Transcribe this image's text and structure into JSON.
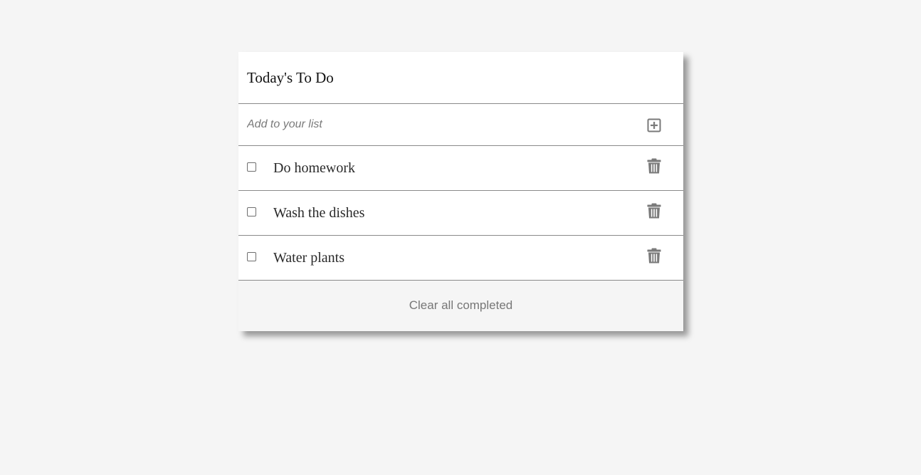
{
  "app": {
    "title": "Today's To Do"
  },
  "add": {
    "placeholder": "Add to your list",
    "value": "",
    "icon": "plus-square-icon"
  },
  "todos": [
    {
      "text": "Do homework",
      "checked": false,
      "delete_icon": "trash-icon"
    },
    {
      "text": "Wash the dishes",
      "checked": false,
      "delete_icon": "trash-icon"
    },
    {
      "text": "Water plants",
      "checked": false,
      "delete_icon": "trash-icon"
    }
  ],
  "footer": {
    "clear_label": "Clear all completed"
  },
  "colors": {
    "page_background": "#f5f5f5",
    "card_background": "#ffffff",
    "divider": "#8a8a8a",
    "icon": "#7a7a7a",
    "muted_text": "#777777"
  }
}
